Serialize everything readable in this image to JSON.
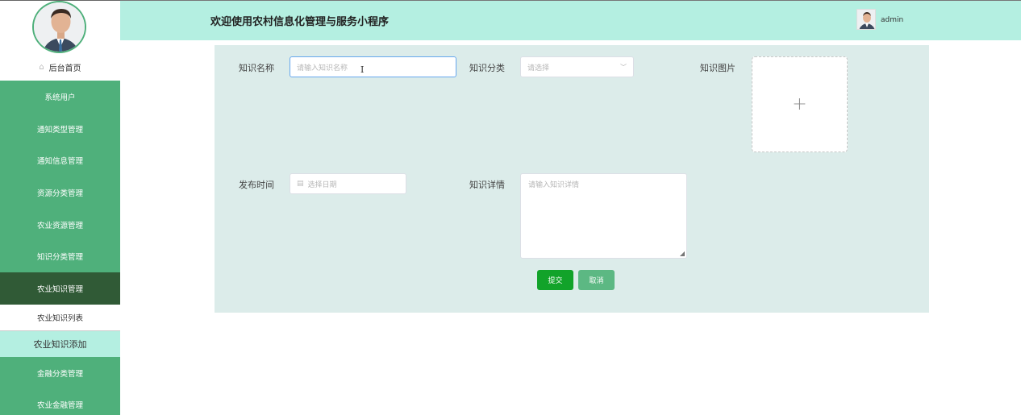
{
  "header": {
    "title": "欢迎使用农村信息化管理与服务小程序",
    "username": "admin"
  },
  "sidebar": {
    "home_label": "后台首页",
    "items": [
      {
        "label": "系统用户"
      },
      {
        "label": "通知类型管理"
      },
      {
        "label": "通知信息管理"
      },
      {
        "label": "资源分类管理"
      },
      {
        "label": "农业资源管理"
      },
      {
        "label": "知识分类管理"
      },
      {
        "label": "农业知识管理"
      }
    ],
    "sub_items": [
      {
        "label": "农业知识列表"
      },
      {
        "label": "农业知识添加"
      }
    ],
    "items_after": [
      {
        "label": "金融分类管理"
      },
      {
        "label": "农业金融管理"
      }
    ]
  },
  "form": {
    "name_label": "知识名称",
    "name_placeholder": "请输入知识名称",
    "category_label": "知识分类",
    "category_placeholder": "请选择",
    "image_label": "知识图片",
    "date_label": "发布时间",
    "date_placeholder": "选择日期",
    "detail_label": "知识详情",
    "detail_placeholder": "请输入知识详情",
    "submit_label": "提交",
    "cancel_label": "取消"
  },
  "icons": {
    "home": "home-icon",
    "calendar": "calendar-icon",
    "chevron": "chevron-down-icon",
    "plus": "plus-icon"
  },
  "colors": {
    "sidebar": "#4fb07b",
    "sidebar_active": "#305a36",
    "header": "#b4efe1",
    "panel": "#dcecea",
    "submit": "#12a32a",
    "cancel": "#5cb883"
  }
}
